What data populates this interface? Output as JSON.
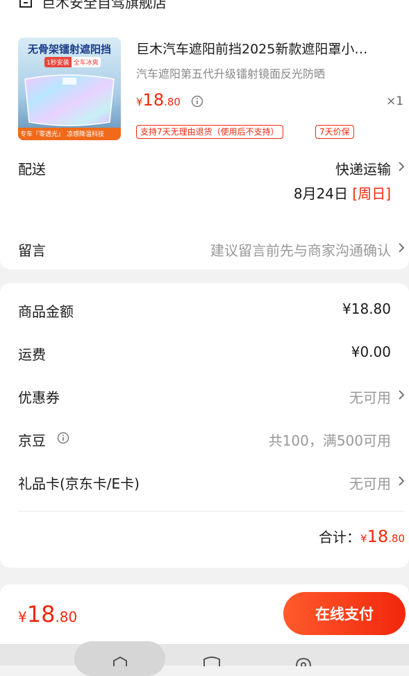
{
  "store": {
    "name": "巨木安全自驾旗舰店",
    "icon": "store-icon"
  },
  "product": {
    "title": "巨木汽车遮阳前挡2025新款遮阳罩小…",
    "subtitle": "汽车遮阳第五代升级镭射镜面反光防晒",
    "price_symbol": "¥",
    "price_int": "18",
    "price_dec": ".80",
    "quantity": "×1",
    "tags": [
      "支持7天无理由退货（使用后不支持）",
      "7天价保"
    ],
    "thumbnail": {
      "headline": "无骨架镭射遮阳挡",
      "badge_left": "1秒安装",
      "badge_right": "全车冰爽",
      "footer_left": "专车『零透光』",
      "footer_right": "凉感降温科技"
    }
  },
  "delivery": {
    "label": "配送",
    "method": "快递运输",
    "date": "8月24日",
    "weekday": "[周日]"
  },
  "message": {
    "label": "留言",
    "placeholder": "建议留言前先与商家沟通确认"
  },
  "summary": {
    "goods": {
      "label": "商品金额",
      "value": "¥18.80"
    },
    "shipping": {
      "label": "运费",
      "value": "¥0.00"
    },
    "coupon": {
      "label": "优惠券",
      "value": "无可用"
    },
    "beans": {
      "label": "京豆",
      "value": "共100，满500可用"
    },
    "giftcard": {
      "label": "礼品卡(京东卡/E卡)",
      "value": "无可用"
    },
    "total": {
      "label": "合计：",
      "symbol": "¥",
      "int": "18",
      "dec": ".80"
    }
  },
  "footer": {
    "symbol": "¥",
    "int": "18",
    "dec": ".80",
    "pay_label": "在线支付"
  },
  "colors": {
    "accent": "#f2270c",
    "gray_text": "#999999"
  }
}
